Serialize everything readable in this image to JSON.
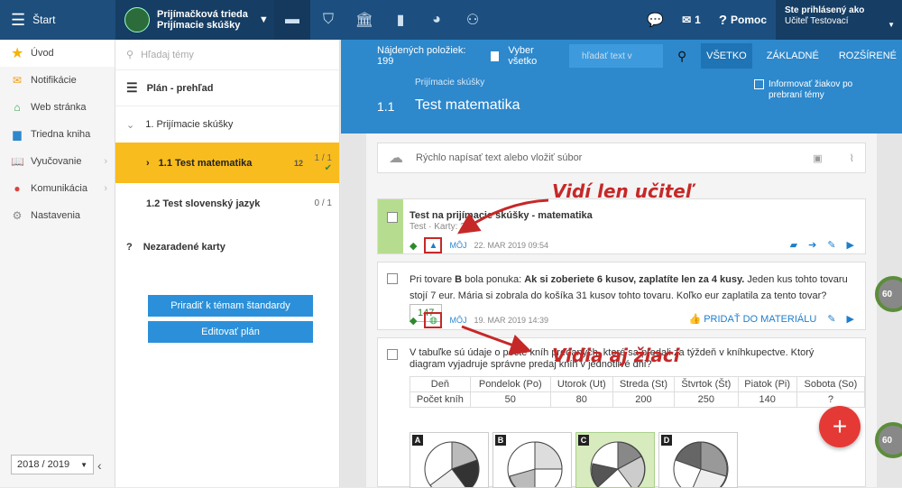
{
  "topbar": {
    "start_label": "Štart",
    "class_name": "Prijímačková trieda",
    "class_sub": "Prijímacie skúšky",
    "mail_count": "1",
    "help_label": "Pomoc",
    "user_label": "Ste prihlásený ako",
    "user_name": "Učiteľ Testovací"
  },
  "sidebar": {
    "items": [
      {
        "label": "Úvod"
      },
      {
        "label": "Notifikácie"
      },
      {
        "label": "Web stránka"
      },
      {
        "label": "Triedna kniha"
      },
      {
        "label": "Vyučovanie"
      },
      {
        "label": "Komunikácia"
      },
      {
        "label": "Nastavenia"
      }
    ],
    "year": "2018 / 2019"
  },
  "plan": {
    "search_placeholder": "Hľadaj témy",
    "title": "Plán - prehľad",
    "group": "1. Prijímacie skúšky",
    "topics": [
      {
        "label": "1.1 Test matematika",
        "count": "12",
        "progress": "1 / 1"
      },
      {
        "label": "1.2 Test slovenský jazyk",
        "progress": "0 / 1"
      }
    ],
    "unassigned_mark": "?",
    "unassigned": "Nezaradené karty",
    "btn_standards": "Priradiť k témam štandardy",
    "btn_edit": "Editovať plán"
  },
  "filter": {
    "found": "Nájdených položiek: 199",
    "select_all": "Vyber všetko",
    "search_placeholder": "hľadať text v",
    "tabs": [
      "VŠETKO",
      "ZÁKLADNÉ",
      "ROZŠÍRENÉ"
    ]
  },
  "header": {
    "subtitle": "Prijímacie skúšky",
    "number": "1.1",
    "title": "Test matematika",
    "inform": "Informovať žiakov po prebraní témy"
  },
  "quick": {
    "placeholder": "Rýchlo napísať text alebo vložiť súbor"
  },
  "cards": [
    {
      "title": "Test na prijímacie skúšky - matematika",
      "meta": "Test · Karty: 2",
      "owner": "MÔJ",
      "date": "22. MAR 2019 09:54"
    },
    {
      "text_a": "Pri tovare ",
      "text_b": "B",
      "text_c": " bola ponuka: ",
      "text_d": "Ak si zoberiete 6 kusov, zaplatíte len za 4 kusy.",
      "text_e": " Jeden kus tohto tovaru stojí 7 eur. Mária si zobrala do košíka 31 kusov tohto tovaru. Koľko eur zaplatila za tento tovar?",
      "answer": "147",
      "owner": "MÔJ",
      "date": "19. MAR 2019 14:39",
      "add": "PRIDAŤ DO MATERIÁLU"
    },
    {
      "text": "V tabuľke sú údaje o počte kníh predaných, ktoré sa predali za týždeň v kníhkupectve. Ktorý diagram vyjadruje správne predaj kníh v jednotlivé dni?",
      "table": {
        "head": [
          "Deň",
          "Pondelok (Po)",
          "Utorok (Ut)",
          "Streda (St)",
          "Štvrtok (Št)",
          "Piatok (Pi)",
          "Sobota (So)"
        ],
        "row_label": "Počet kníh",
        "values": [
          "50",
          "80",
          "200",
          "250",
          "140",
          "?"
        ]
      },
      "options": [
        "A",
        "B",
        "C",
        "D"
      ]
    }
  ],
  "annotations": {
    "teacher": "Vidí len učiteľ",
    "students": "Vidia aj žiaci"
  },
  "progress": [
    "60",
    "60"
  ],
  "fab": "+"
}
